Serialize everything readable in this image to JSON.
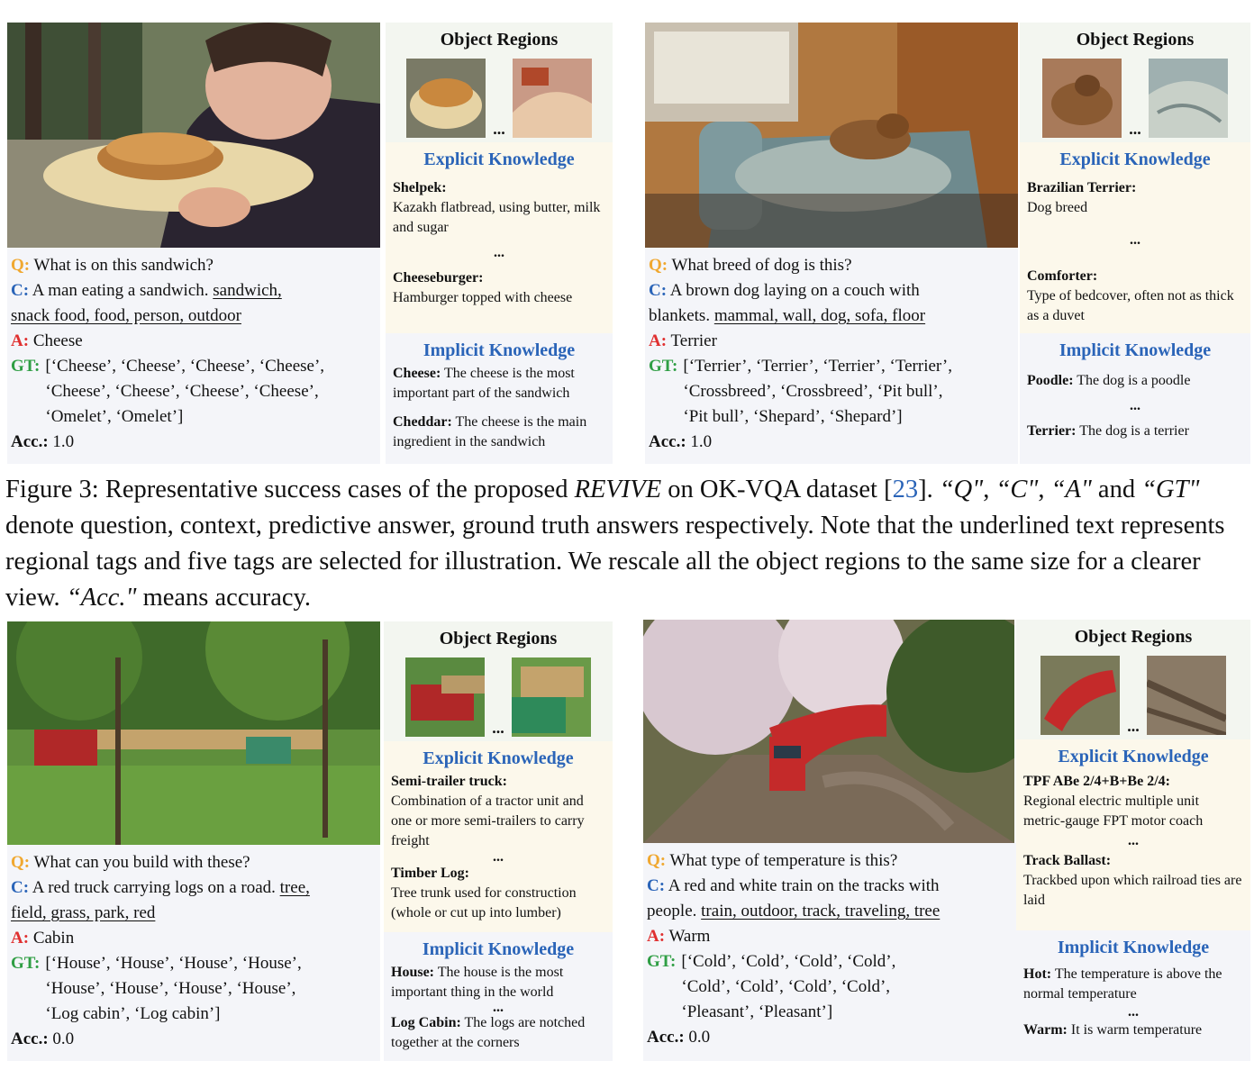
{
  "panels": [
    {
      "question_label": "Q:",
      "question": "What is on this sandwich?",
      "context_label": "C:",
      "context_plain": "A man eating a sandwich.",
      "context_tags_1": "sandwich,",
      "context_tags_2": "snack food, food, person, outdoor",
      "answer_label": "A:",
      "answer": "Cheese",
      "gt_label": "GT:",
      "gt_1": "[‘Cheese’, ‘Cheese’, ‘Cheese’, ‘Cheese’,",
      "gt_2": "‘Cheese’, ‘Cheese’, ‘Cheese’, ‘Cheese’,",
      "gt_3": "‘Omelet’, ‘Omelet’]",
      "acc_label": "Acc.:",
      "acc": "1.0",
      "object_regions_title": "Object Regions",
      "ellipsis": "...",
      "explicit_title": "Explicit Knowledge",
      "explicit": [
        {
          "term": "Shelpek:",
          "desc": "Kazakh flatbread, using butter, milk and sugar"
        },
        {
          "term": "Cheeseburger:",
          "desc": "Hamburger topped with cheese"
        }
      ],
      "implicit_title": "Implicit Knowledge",
      "implicit": [
        {
          "term": "Cheese:",
          "desc": "The cheese is the most important part of the sandwich"
        },
        {
          "term": "Cheddar:",
          "desc": "The cheese is the main ingredient in the sandwich"
        }
      ]
    },
    {
      "question_label": "Q:",
      "question": "What breed of dog is this?",
      "context_label": "C:",
      "context_plain": "A brown dog laying on a couch with",
      "context_plain_2": "blankets.",
      "context_tags_2": "mammal, wall, dog, sofa, floor",
      "answer_label": "A:",
      "answer": "Terrier",
      "gt_label": "GT:",
      "gt_1": "[‘Terrier’, ‘Terrier’, ‘Terrier’,  ‘Terrier’,",
      "gt_2": "‘Crossbreed’, ‘Crossbreed’, ‘Pit bull’,",
      "gt_3": "‘Pit bull’, ‘Shepard’, ‘Shepard’]",
      "acc_label": "Acc.:",
      "acc": "1.0",
      "object_regions_title": "Object Regions",
      "ellipsis": "...",
      "explicit_title": "Explicit Knowledge",
      "explicit": [
        {
          "term": "Brazilian Terrier:",
          "desc": "Dog breed"
        },
        {
          "term": "Comforter:",
          "desc": "Type of bedcover, often not as thick as a duvet"
        }
      ],
      "implicit_title": "Implicit Knowledge",
      "implicit": [
        {
          "term": "Poodle:",
          "desc": "The dog is a poodle"
        },
        {
          "term": "Terrier:",
          "desc": "The dog is a terrier"
        }
      ]
    },
    {
      "question_label": "Q:",
      "question": "What can you build with these?",
      "context_label": "C:",
      "context_plain": "A red truck carrying logs on a road.",
      "context_tags_1": "tree,",
      "context_tags_2": "field, grass, park, red",
      "answer_label": "A:",
      "answer": "Cabin",
      "gt_label": "GT:",
      "gt_1": "[‘House’, ‘House’, ‘House’, ‘House’,",
      "gt_2": "‘House’, ‘House’, ‘House’, ‘House’,",
      "gt_3": "‘Log cabin’, ‘Log cabin’]",
      "acc_label": "Acc.:",
      "acc": "0.0",
      "object_regions_title": "Object Regions",
      "ellipsis": "...",
      "explicit_title": "Explicit Knowledge",
      "explicit": [
        {
          "term": "Semi-trailer truck:",
          "desc": "Combination of a tractor unit and one or more semi-trailers to carry freight"
        },
        {
          "term": "Timber Log:",
          "desc": "Tree trunk used for construction (whole or cut up into lumber)"
        }
      ],
      "implicit_title": "Implicit Knowledge",
      "implicit": [
        {
          "term": "House:",
          "desc": "The house is the most important thing in the world"
        },
        {
          "term": "Log Cabin:",
          "desc": "The logs are notched together at the corners"
        }
      ]
    },
    {
      "question_label": "Q:",
      "question": "What type of temperature is this?",
      "context_label": "C:",
      "context_plain": "A red and white train on the tracks with",
      "context_plain_2": "people.",
      "context_tags_2": "train, outdoor, track, traveling, tree",
      "answer_label": "A:",
      "answer": "Warm",
      "gt_label": "GT:",
      "gt_1": "[‘Cold’, ‘Cold’, ‘Cold’, ‘Cold’,",
      "gt_2": "‘Cold’, ‘Cold’, ‘Cold’, ‘Cold’,",
      "gt_3": "‘Pleasant’, ‘Pleasant’]",
      "acc_label": "Acc.:",
      "acc": "0.0",
      "object_regions_title": "Object Regions",
      "ellipsis": "...",
      "explicit_title": "Explicit Knowledge",
      "explicit": [
        {
          "term": "TPF ABe 2/4+B+Be 2/4:",
          "desc": "Regional electric multiple unit metric-gauge FPT motor coach"
        },
        {
          "term": "Track Ballast:",
          "desc": "Trackbed upon which railroad ties are laid"
        }
      ],
      "implicit_title": "Implicit Knowledge",
      "implicit": [
        {
          "term": "Hot:",
          "desc": "The temperature is above the normal temperature"
        },
        {
          "term": "Warm:",
          "desc": "It is warm temperature"
        }
      ]
    }
  ],
  "caption": {
    "p1": "Figure 3: Representative success cases of the proposed ",
    "method": "REVIVE",
    "p2": " on OK-VQA dataset [",
    "cite": "23",
    "p3": "].  ",
    "q": "“Q\"",
    "sep1": ", ",
    "c": "“C\"",
    "sep2": ",",
    "a": "“A\"",
    "and": " and ",
    "gt": "“GT\"",
    "p4": " denote question, context, predictive answer, ground truth answers respectively. Note that the underlined text represents regional tags and five tags are selected for illustration. We rescale all the object regions to the same size for a clearer view.  ",
    "acc": "“Acc.\"",
    "p5": " means accuracy."
  }
}
